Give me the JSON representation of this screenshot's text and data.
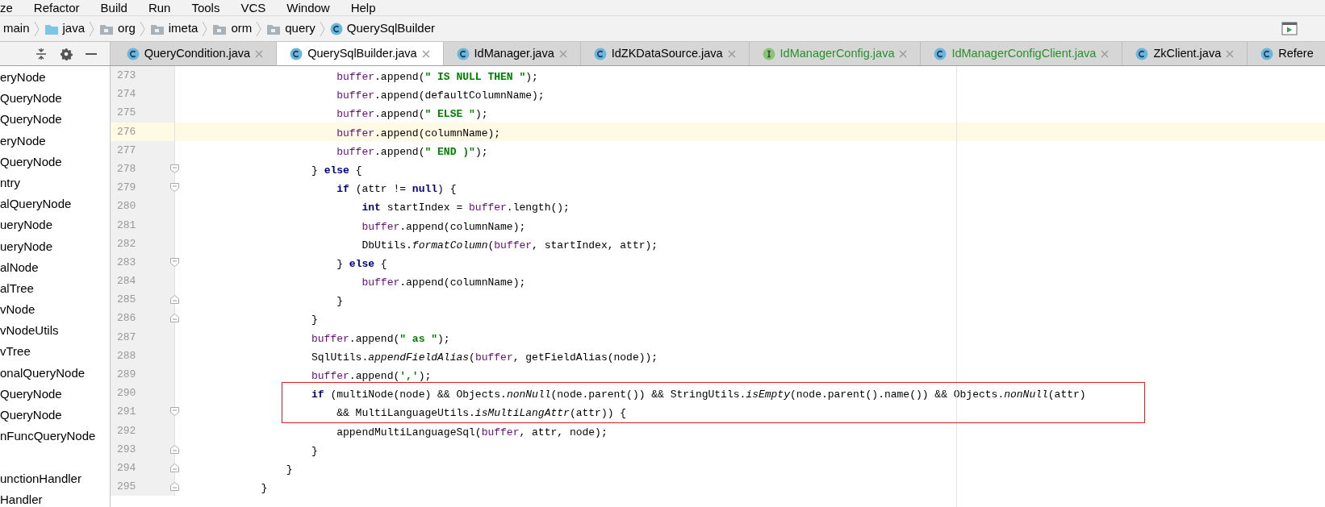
{
  "menu": [
    "ze",
    "Refactor",
    "Build",
    "Run",
    "Tools",
    "VCS",
    "Window",
    "Help"
  ],
  "breadcrumbs": [
    {
      "label": "main",
      "kind": "none"
    },
    {
      "label": "java",
      "kind": "source-folder"
    },
    {
      "label": "org",
      "kind": "package"
    },
    {
      "label": "imeta",
      "kind": "package"
    },
    {
      "label": "orm",
      "kind": "package"
    },
    {
      "label": "query",
      "kind": "package"
    },
    {
      "label": "QuerySqlBuilder",
      "kind": "class"
    }
  ],
  "tabs": [
    {
      "label": "QueryCondition.java",
      "kind": "class",
      "selected": false,
      "added": false
    },
    {
      "label": "QuerySqlBuilder.java",
      "kind": "class",
      "selected": true,
      "added": false
    },
    {
      "label": "IdManager.java",
      "kind": "class",
      "selected": false,
      "added": false
    },
    {
      "label": "IdZKDataSource.java",
      "kind": "class",
      "selected": false,
      "added": false
    },
    {
      "label": "IdManagerConfig.java",
      "kind": "interface",
      "selected": false,
      "added": true
    },
    {
      "label": "IdManagerConfigClient.java",
      "kind": "class",
      "selected": false,
      "added": true
    },
    {
      "label": "ZkClient.java",
      "kind": "class",
      "selected": false,
      "added": false
    },
    {
      "label": "Refere",
      "kind": "class",
      "selected": false,
      "added": false
    }
  ],
  "sidebar": {
    "groups": [
      [
        "eryNode",
        "QueryNode",
        "QueryNode",
        "eryNode",
        "QueryNode",
        "ntry",
        "alQueryNode",
        "ueryNode",
        "ueryNode",
        "alNode",
        "alTree",
        "vNode",
        "vNodeUtils",
        "vTree",
        "onalQueryNode",
        "QueryNode",
        "QueryNode",
        "nFuncQueryNode"
      ],
      [
        "unctionHandler",
        "Handler"
      ]
    ]
  },
  "lines": [
    {
      "number": "273",
      "fold_start": false,
      "fold_end": false,
      "current": false,
      "boxed": false,
      "segments": [
        {
          "kind": "field",
          "text": "                        buffer"
        },
        {
          "kind": "plain",
          "text": ".append("
        },
        {
          "kind": "string",
          "text": "\" IS NULL THEN \""
        },
        {
          "kind": "plain",
          "text": ");"
        }
      ]
    },
    {
      "number": "274",
      "fold_start": false,
      "fold_end": false,
      "current": false,
      "boxed": false,
      "segments": [
        {
          "kind": "field",
          "text": "                        buffer"
        },
        {
          "kind": "plain",
          "text": ".append(defaultColumnName);"
        }
      ]
    },
    {
      "number": "275",
      "fold_start": false,
      "fold_end": false,
      "current": false,
      "boxed": false,
      "segments": [
        {
          "kind": "field",
          "text": "                        buffer"
        },
        {
          "kind": "plain",
          "text": ".append("
        },
        {
          "kind": "string",
          "text": "\" ELSE \""
        },
        {
          "kind": "plain",
          "text": ");"
        }
      ]
    },
    {
      "number": "276",
      "fold_start": false,
      "fold_end": false,
      "current": true,
      "boxed": false,
      "segments": [
        {
          "kind": "field",
          "text": "                        buffer"
        },
        {
          "kind": "plain",
          "text": ".append(columnName);"
        }
      ]
    },
    {
      "number": "277",
      "fold_start": false,
      "fold_end": false,
      "current": false,
      "boxed": false,
      "segments": [
        {
          "kind": "field",
          "text": "                        buffer"
        },
        {
          "kind": "plain",
          "text": ".append("
        },
        {
          "kind": "string",
          "text": "\" END )\""
        },
        {
          "kind": "plain",
          "text": ");"
        }
      ]
    },
    {
      "number": "278",
      "fold_start": true,
      "fold_end": false,
      "current": false,
      "boxed": false,
      "segments": [
        {
          "kind": "plain",
          "text": "                    } "
        },
        {
          "kind": "keyword",
          "text": "else"
        },
        {
          "kind": "plain",
          "text": " {"
        }
      ]
    },
    {
      "number": "279",
      "fold_start": true,
      "fold_end": false,
      "current": false,
      "boxed": false,
      "segments": [
        {
          "kind": "keyword",
          "text": "                        if"
        },
        {
          "kind": "plain",
          "text": " (attr != "
        },
        {
          "kind": "keyword",
          "text": "null"
        },
        {
          "kind": "plain",
          "text": ") {"
        }
      ]
    },
    {
      "number": "280",
      "fold_start": false,
      "fold_end": false,
      "current": false,
      "boxed": false,
      "segments": [
        {
          "kind": "keyword",
          "text": "                            int"
        },
        {
          "kind": "plain",
          "text": " startIndex = "
        },
        {
          "kind": "field",
          "text": "buffer"
        },
        {
          "kind": "plain",
          "text": ".length();"
        }
      ]
    },
    {
      "number": "281",
      "fold_start": false,
      "fold_end": false,
      "current": false,
      "boxed": false,
      "segments": [
        {
          "kind": "field",
          "text": "                            buffer"
        },
        {
          "kind": "plain",
          "text": ".append(columnName);"
        }
      ]
    },
    {
      "number": "282",
      "fold_start": false,
      "fold_end": false,
      "current": false,
      "boxed": false,
      "segments": [
        {
          "kind": "plain",
          "text": "                            DbUtils."
        },
        {
          "kind": "static",
          "text": "formatColumn"
        },
        {
          "kind": "plain",
          "text": "("
        },
        {
          "kind": "field",
          "text": "buffer"
        },
        {
          "kind": "plain",
          "text": ", startIndex, attr);"
        }
      ]
    },
    {
      "number": "283",
      "fold_start": true,
      "fold_end": false,
      "current": false,
      "boxed": false,
      "segments": [
        {
          "kind": "plain",
          "text": "                        } "
        },
        {
          "kind": "keyword",
          "text": "else"
        },
        {
          "kind": "plain",
          "text": " {"
        }
      ]
    },
    {
      "number": "284",
      "fold_start": false,
      "fold_end": false,
      "current": false,
      "boxed": false,
      "segments": [
        {
          "kind": "field",
          "text": "                            buffer"
        },
        {
          "kind": "plain",
          "text": ".append(columnName);"
        }
      ]
    },
    {
      "number": "285",
      "fold_start": false,
      "fold_end": true,
      "current": false,
      "boxed": false,
      "segments": [
        {
          "kind": "plain",
          "text": "                        }"
        }
      ]
    },
    {
      "number": "286",
      "fold_start": false,
      "fold_end": true,
      "current": false,
      "boxed": false,
      "segments": [
        {
          "kind": "plain",
          "text": "                    }"
        }
      ]
    },
    {
      "number": "287",
      "fold_start": false,
      "fold_end": false,
      "current": false,
      "boxed": false,
      "segments": [
        {
          "kind": "field",
          "text": "                    buffer"
        },
        {
          "kind": "plain",
          "text": ".append("
        },
        {
          "kind": "string",
          "text": "\" as \""
        },
        {
          "kind": "plain",
          "text": ");"
        }
      ]
    },
    {
      "number": "288",
      "fold_start": false,
      "fold_end": false,
      "current": false,
      "boxed": false,
      "segments": [
        {
          "kind": "plain",
          "text": "                    SqlUtils."
        },
        {
          "kind": "static",
          "text": "appendFieldAlias"
        },
        {
          "kind": "plain",
          "text": "("
        },
        {
          "kind": "field",
          "text": "buffer"
        },
        {
          "kind": "plain",
          "text": ", getFieldAlias(node));"
        }
      ]
    },
    {
      "number": "289",
      "fold_start": false,
      "fold_end": false,
      "current": false,
      "boxed": false,
      "segments": [
        {
          "kind": "field",
          "text": "                    buffer"
        },
        {
          "kind": "plain",
          "text": ".append("
        },
        {
          "kind": "string",
          "text": "','"
        },
        {
          "kind": "plain",
          "text": ");"
        }
      ]
    },
    {
      "number": "290",
      "fold_start": false,
      "fold_end": false,
      "current": false,
      "boxed": true,
      "segments": [
        {
          "kind": "keyword",
          "text": "                    if"
        },
        {
          "kind": "plain",
          "text": " (multiNode(node) && Objects."
        },
        {
          "kind": "static",
          "text": "nonNull"
        },
        {
          "kind": "plain",
          "text": "(node.parent()) && StringUtils."
        },
        {
          "kind": "static",
          "text": "isEmpty"
        },
        {
          "kind": "plain",
          "text": "(node.parent().name()) && Objects."
        },
        {
          "kind": "static",
          "text": "nonNull"
        },
        {
          "kind": "plain",
          "text": "(attr)"
        }
      ]
    },
    {
      "number": "291",
      "fold_start": true,
      "fold_end": false,
      "current": false,
      "boxed": true,
      "segments": [
        {
          "kind": "plain",
          "text": "                        && MultiLanguageUtils."
        },
        {
          "kind": "static",
          "text": "isMultiLangAttr"
        },
        {
          "kind": "plain",
          "text": "(attr)) {"
        }
      ]
    },
    {
      "number": "292",
      "fold_start": false,
      "fold_end": false,
      "current": false,
      "boxed": false,
      "segments": [
        {
          "kind": "plain",
          "text": "                        appendMultiLanguageSql("
        },
        {
          "kind": "field",
          "text": "buffer"
        },
        {
          "kind": "plain",
          "text": ", attr, node);"
        }
      ]
    },
    {
      "number": "293",
      "fold_start": false,
      "fold_end": true,
      "current": false,
      "boxed": false,
      "segments": [
        {
          "kind": "plain",
          "text": "                    }"
        }
      ]
    },
    {
      "number": "294",
      "fold_start": false,
      "fold_end": true,
      "current": false,
      "boxed": false,
      "segments": [
        {
          "kind": "plain",
          "text": "                }"
        }
      ]
    },
    {
      "number": "295",
      "fold_start": false,
      "fold_end": true,
      "current": false,
      "boxed": false,
      "segments": [
        {
          "kind": "plain",
          "text": "            }"
        }
      ]
    }
  ]
}
